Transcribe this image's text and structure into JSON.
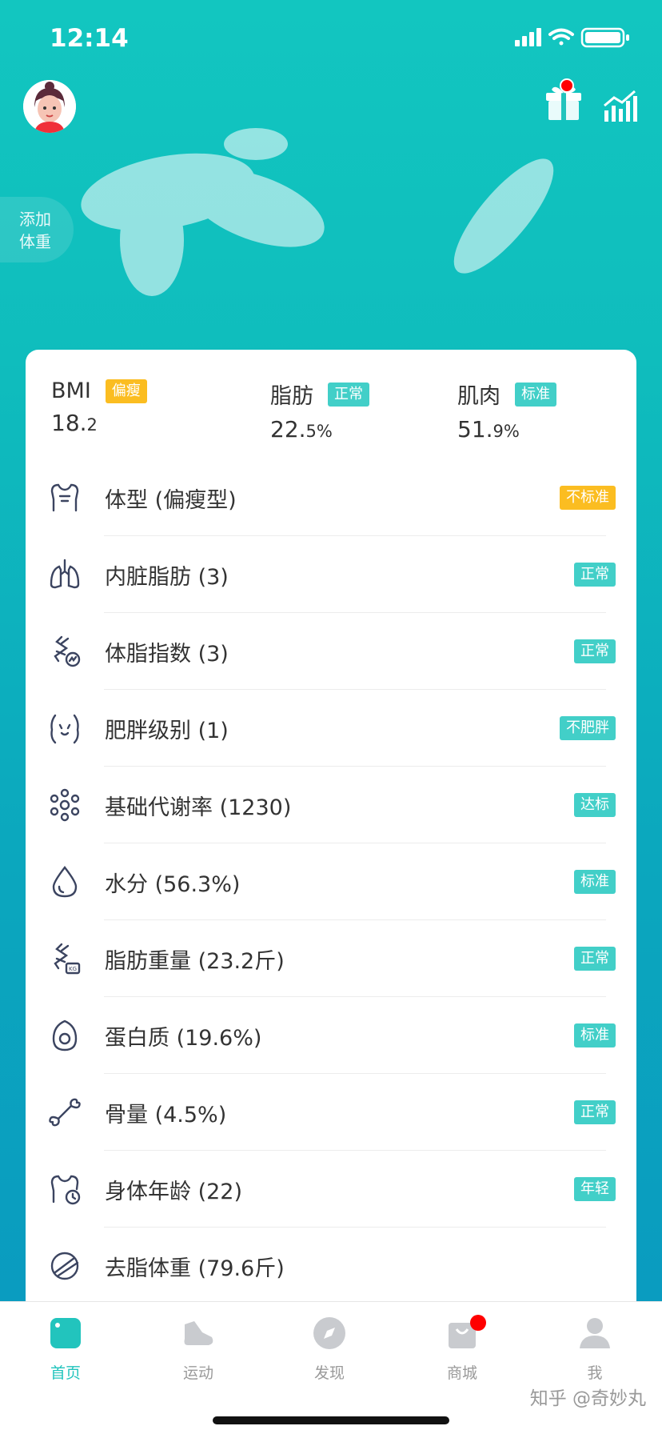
{
  "status_bar": {
    "time": "12:14"
  },
  "header": {
    "add_weight_line1": "添加",
    "add_weight_line2": "体重"
  },
  "metrics": [
    {
      "name": "BMI",
      "tag": "偏瘦",
      "value_int": "18.",
      "value_dec": "2",
      "unit": "",
      "tag_color": "#fbbd21"
    },
    {
      "name": "脂肪",
      "tag": "正常",
      "value_int": "22.",
      "value_dec": "5",
      "unit": "%",
      "tag_color": "#42cfc8"
    },
    {
      "name": "肌肉",
      "tag": "标准",
      "value_int": "51.",
      "value_dec": "9",
      "unit": "%",
      "tag_color": "#42cfc8"
    }
  ],
  "rows": [
    {
      "icon": "body-shape-icon",
      "label": "体型 (偏瘦型)",
      "status": "不标准",
      "color": "yellow"
    },
    {
      "icon": "lungs-icon",
      "label": "内脏脂肪 (3)",
      "status": "正常",
      "color": "teal"
    },
    {
      "icon": "body-fat-index-icon",
      "label": "体脂指数 (3)",
      "status": "正常",
      "color": "teal"
    },
    {
      "icon": "obesity-level-icon",
      "label": "肥胖级别 (1)",
      "status": "不肥胖",
      "color": "teal"
    },
    {
      "icon": "metabolism-icon",
      "label": "基础代谢率 (1230)",
      "status": "达标",
      "color": "teal"
    },
    {
      "icon": "water-drop-icon",
      "label": "水分 (56.3%)",
      "status": "标准",
      "color": "teal"
    },
    {
      "icon": "fat-weight-icon",
      "label": "脂肪重量 (23.2斤)",
      "status": "正常",
      "color": "teal"
    },
    {
      "icon": "protein-egg-icon",
      "label": "蛋白质 (19.6%)",
      "status": "标准",
      "color": "teal"
    },
    {
      "icon": "bone-icon",
      "label": "骨量 (4.5%)",
      "status": "正常",
      "color": "teal"
    },
    {
      "icon": "body-age-icon",
      "label": "身体年龄 (22)",
      "status": "年轻",
      "color": "teal"
    },
    {
      "icon": "lean-mass-icon",
      "label": "去脂体重 (79.6斤)",
      "status": "",
      "color": ""
    }
  ],
  "tabs": [
    {
      "label": "首页",
      "icon": "home-icon",
      "active": true
    },
    {
      "label": "运动",
      "icon": "shoe-icon",
      "active": false
    },
    {
      "label": "发现",
      "icon": "compass-icon",
      "active": false
    },
    {
      "label": "商城",
      "icon": "shopping-bag-icon",
      "active": false,
      "badge": true
    },
    {
      "label": "我",
      "icon": "person-icon",
      "active": false
    }
  ],
  "watermark": "知乎 @奇妙丸",
  "colors": {
    "accent": "#22c4bd",
    "warning": "#fbbd21",
    "tag_teal": "#42cfc8"
  }
}
